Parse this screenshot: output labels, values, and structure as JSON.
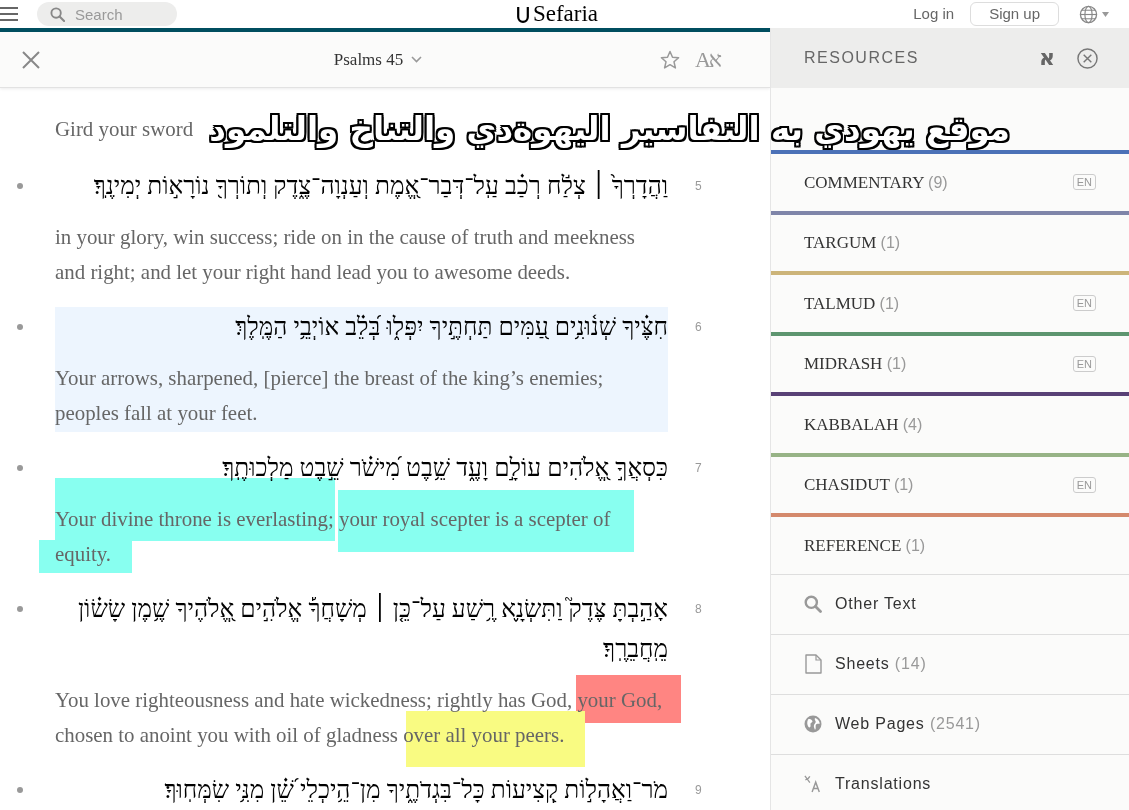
{
  "top_nav": {
    "search": {
      "placeholder": "Search"
    },
    "logo": "Sefaria",
    "login": "Log in",
    "signup": "Sign up"
  },
  "reader": {
    "title": "Psalms 45",
    "font_toggle": "Aא",
    "partial_text": "Gird your sword",
    "verses": [
      {
        "number": "5",
        "selected": false,
        "hebrew": "וַהֲדָרְךָ֙ ׀ צְלַ֬ח רְכַ֗ב עַֽל־דְּבַר־אֱ֭מֶת וְעַנְוָה־צֶ֑דֶק וְתוֹרְךָ֖ נוֹרָא֣וֹת יְמִינֶֽךָ׃",
        "english": "in your glory, win success; ride on in the cause of truth and meekness and right; and let your right hand lead you to awesome deeds."
      },
      {
        "number": "6",
        "selected": true,
        "hebrew": "חִצֶּ֗יךָ שְׁנ֫וּנִ֥ים עַ֭מִּים תַּחְתֶּ֣יךָ יִפְּל֑וּ בְּ֝לֵ֗ב אוֹיְבֵ֥י הַמֶּֽלֶךְ׃",
        "english": "Your arrows, sharpened, [pierce] the breast of the king’s enemies; peoples fall at your feet."
      },
      {
        "number": "7",
        "selected": false,
        "hebrew": "כִּסְאֲךָ֣ אֱ֭לֹהִים עוֹלָ֣ם וָעֶ֑ד שֵׁ֥בֶט מִ֝ישֹׁ֗ר שֵׁ֣בֶט מַלְכוּתֶֽךָ׃",
        "english": "Your divine throne is everlasting; your royal scepter is a scepter of equity.",
        "highlights": [
          {
            "color": "#88fff0"
          },
          {
            "color": "#88fff0"
          },
          {
            "color": "#88fff0"
          }
        ]
      },
      {
        "number": "8",
        "selected": false,
        "hebrew": "אָהַ֣בְתָּ צֶּדֶק֮ וַתִּשְׂנָ֪א רֶ֥שַׁע עַל־כֵּ֤ן ׀ מְשָׁחֲךָ֡ אֱלֹהִ֣ים אֱ֭לֹהֶיךָ שֶׁ֥מֶן שָׂשׂ֗וֹן מֵֽחֲבֵרֶֽךָ׃",
        "english": "You love righteousness and hate wickedness; rightly has God, your God, chosen to anoint you with oil of gladness over all your peers.",
        "highlights": [
          {
            "color": "#ff8582"
          },
          {
            "color": "#f9fb82"
          }
        ]
      },
      {
        "number": "9",
        "selected": false,
        "hebrew": "מֹר־וַאֲהָל֣וֹת קְ֭צִיעוֹת כָּל־בִּגְדֹתֶ֑יךָ מִן־הֵ֥יכְלֵי שֵׁ֝֗ן מִנִּ֥י שִׂמְּחֽוּךָ׃"
      }
    ]
  },
  "resources": {
    "title": "RESOURCES",
    "language_toggle": "א",
    "categories": [
      {
        "name": "COMMENTARY",
        "count": "(9)",
        "color": "#4b71b7",
        "badge": "EN"
      },
      {
        "name": "TARGUM",
        "count": "(1)",
        "color": "#7f85a9"
      },
      {
        "name": "TALMUD",
        "count": "(1)",
        "color": "#ccb479",
        "badge": "EN"
      },
      {
        "name": "MIDRASH",
        "count": "(1)",
        "color": "#5d956f",
        "badge": "EN"
      },
      {
        "name": "KABBALAH",
        "count": "(4)",
        "color": "#594176"
      },
      {
        "name": "CHASIDUT",
        "count": "(1)",
        "color": "#97b386",
        "badge": "EN"
      },
      {
        "name": "REFERENCE",
        "count": "(1)",
        "color": "#d4896c"
      }
    ],
    "tools": [
      {
        "kind": "search",
        "label": "Other Text"
      },
      {
        "kind": "sheet",
        "label": "Sheets",
        "count": "(14)"
      },
      {
        "kind": "web",
        "label": "Web Pages",
        "count": "(2541)"
      },
      {
        "kind": "translate",
        "label": "Translations"
      }
    ]
  },
  "overlay_caption": "موقع يهودي به التفاسير اليهوةدي والتناخ والتلمود"
}
